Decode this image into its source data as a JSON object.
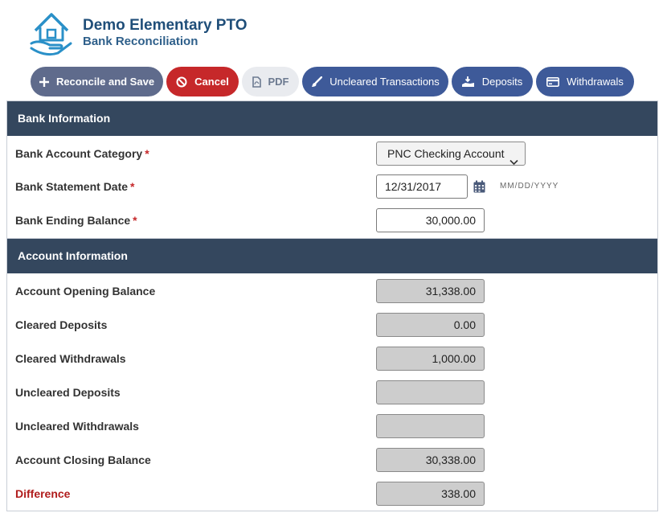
{
  "header": {
    "org_name": "Demo Elementary PTO",
    "page_subtitle": "Bank Reconciliation",
    "logo_icon": "house-in-hand-icon"
  },
  "toolbar": {
    "reconcile_label": "Reconcile and Save",
    "cancel_label": "Cancel",
    "pdf_label": "PDF",
    "uncleared_label": "Uncleared Transactions",
    "deposits_label": "Deposits",
    "withdrawals_label": "Withdrawals"
  },
  "bank_info": {
    "heading": "Bank Information",
    "fields": {
      "account_category": {
        "label": "Bank Account Category",
        "required": "*",
        "value": "PNC Checking Account"
      },
      "statement_date": {
        "label": "Bank Statement Date",
        "required": "*",
        "value": "12/31/2017",
        "format_hint": "MM/DD/YYYY"
      },
      "ending_balance": {
        "label": "Bank Ending Balance",
        "required": "*",
        "value": "30,000.00"
      }
    }
  },
  "account_info": {
    "heading": "Account Information",
    "fields": {
      "opening_balance": {
        "label": "Account Opening Balance",
        "value": "31,338.00"
      },
      "cleared_deposits": {
        "label": "Cleared Deposits",
        "value": "0.00"
      },
      "cleared_withdrawals": {
        "label": "Cleared Withdrawals",
        "value": "1,000.00"
      },
      "uncleared_deposits": {
        "label": "Uncleared Deposits",
        "value": ""
      },
      "uncleared_withdrawals": {
        "label": "Uncleared Withdrawals",
        "value": ""
      },
      "closing_balance": {
        "label": "Account Closing Balance",
        "value": "30,338.00"
      },
      "difference": {
        "label": "Difference",
        "value": "338.00"
      }
    }
  },
  "colors": {
    "header_bar": "#34475e",
    "primary_button": "#3e5a99",
    "cancel_button": "#c6282a",
    "reconcile_button": "#5f6b8c",
    "difference_label": "#b01c1c"
  }
}
